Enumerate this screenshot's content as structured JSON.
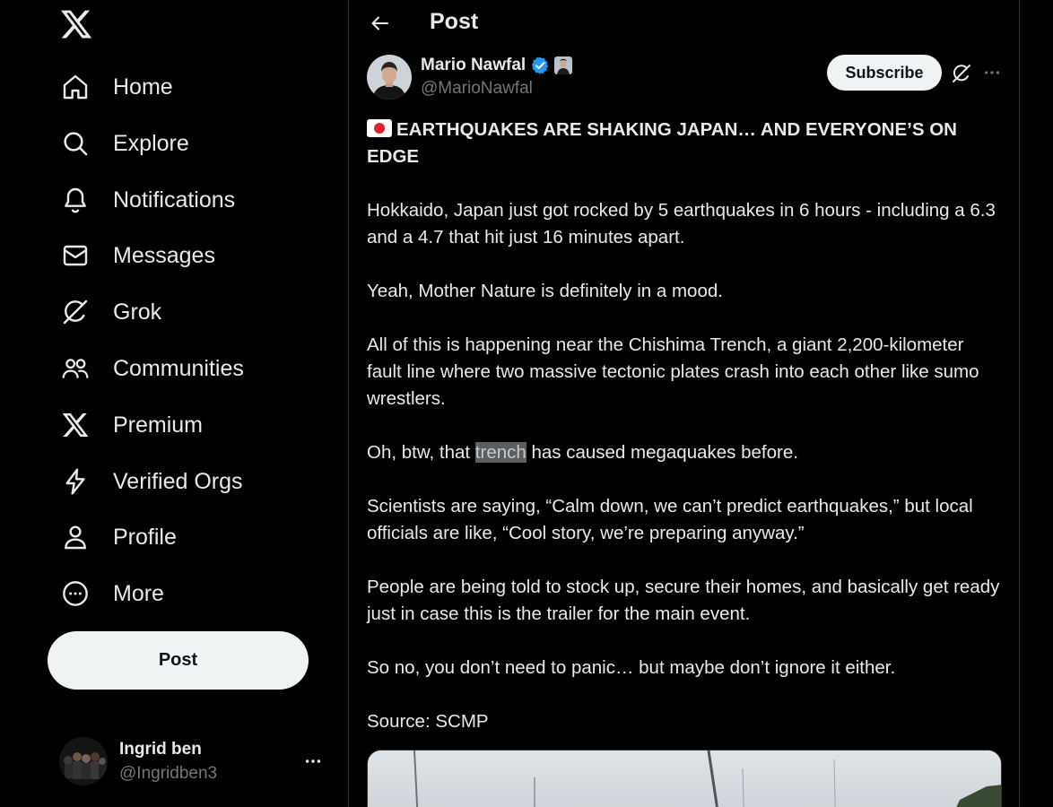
{
  "nav": {
    "items": [
      {
        "label": "Home",
        "icon": "home-icon"
      },
      {
        "label": "Explore",
        "icon": "search-icon"
      },
      {
        "label": "Notifications",
        "icon": "bell-icon"
      },
      {
        "label": "Messages",
        "icon": "envelope-icon"
      },
      {
        "label": "Grok",
        "icon": "grok-icon"
      },
      {
        "label": "Communities",
        "icon": "communities-icon"
      },
      {
        "label": "Premium",
        "icon": "x-logo-icon"
      },
      {
        "label": "Verified Orgs",
        "icon": "lightning-icon"
      },
      {
        "label": "Profile",
        "icon": "person-icon"
      },
      {
        "label": "More",
        "icon": "more-circle-icon"
      }
    ],
    "post_label": "Post"
  },
  "account": {
    "name": "Ingrid ben",
    "handle": "@Ingridben3"
  },
  "header": {
    "title": "Post"
  },
  "tweet": {
    "author_name": "Mario Nawfal",
    "author_handle": "@MarioNawfal",
    "subscribe_label": "Subscribe",
    "headline": "EARTHQUAKES ARE SHAKING JAPAN… AND EVERYONE’S ON EDGE",
    "p1": "Hokkaido, Japan just got rocked by 5 earthquakes in 6 hours -  including a 6.3 and a 4.7 that hit just 16 minutes apart.",
    "p2": "Yeah, Mother Nature is definitely in a mood.",
    "p3": "All of this is happening near the Chishima Trench, a giant 2,200-kilometer fault line where two massive tectonic plates crash into each other like sumo wrestlers.",
    "p4_before": "Oh, btw, that ",
    "p4_highlight": "trench",
    "p4_after": " has caused megaquakes before.",
    "p5": "Scientists are saying, “Calm down, we can’t predict earthquakes,” but local officials are like, “Cool story, we’re preparing anyway.”",
    "p6": "People are being told to stock up, secure their homes, and basically get ready just in case this is the trailer for the main event.",
    "p7": "So no, you don’t need to panic… but maybe don’t ignore it either.",
    "p8": "Source: SCMP"
  },
  "colors": {
    "background": "#000000",
    "text": "#e7e9ea",
    "muted": "#71767b",
    "verified": "#1d9bf0",
    "button_bg": "#eff3f4",
    "border": "#2f3336"
  }
}
